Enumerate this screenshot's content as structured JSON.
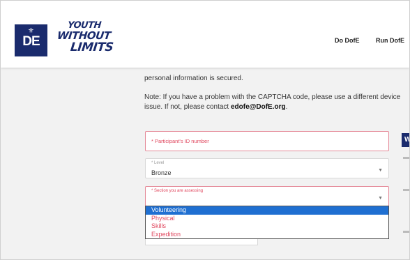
{
  "header": {
    "logo_crown": "⚜",
    "logo_text": "DE",
    "slogan": [
      "YOUTH",
      "WITHOUT",
      "LIMITS"
    ],
    "nav": [
      "Do DofE",
      "Run DofE"
    ]
  },
  "content": {
    "partial_line": "personal information is secured.",
    "note_prefix": "Note: If you have a problem with the CAPTCHA code, please use a different device",
    "note_line2_prefix": "issue. If not, please contact ",
    "note_email": "edofe@DofE.org",
    "note_line2_suffix": "."
  },
  "form": {
    "participant_id": {
      "placeholder": "* Participant's ID number"
    },
    "level": {
      "label": "* Level",
      "value": "Bronze"
    },
    "section": {
      "label": "* Section you are assessing",
      "options": [
        "Volunteering",
        "Physical",
        "Skills",
        "Expedition"
      ],
      "highlighted": "Volunteering"
    }
  },
  "sidebar": {
    "tab_label": "W"
  },
  "colors": {
    "brand_navy": "#1a2b6d",
    "error_pink": "#e0485f",
    "highlight_blue": "#1f6fd1"
  }
}
